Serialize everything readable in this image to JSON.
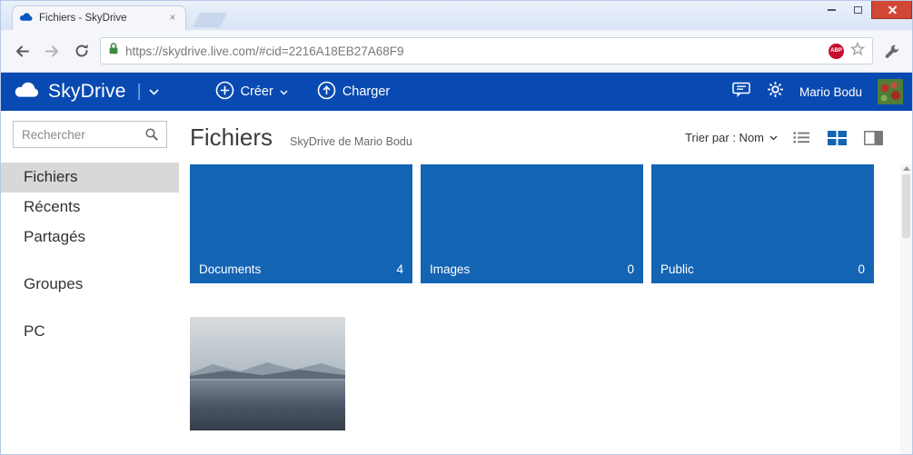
{
  "browser": {
    "tab_title": "Fichiers - SkyDrive",
    "url": "https://skydrive.live.com/#cid=2216A18EB27A68F9",
    "abp_badge": "ABP"
  },
  "app_header": {
    "brand": "SkyDrive",
    "create_label": "Créer",
    "upload_label": "Charger",
    "user_name": "Mario Bodu"
  },
  "sidebar": {
    "search_placeholder": "Rechercher",
    "items": [
      {
        "label": "Fichiers"
      },
      {
        "label": "Récents"
      },
      {
        "label": "Partagés"
      },
      {
        "label": "Groupes"
      },
      {
        "label": "PC"
      }
    ]
  },
  "content": {
    "title": "Fichiers",
    "subtitle": "SkyDrive de Mario Bodu",
    "sort_label": "Trier par : Nom",
    "folders": [
      {
        "name": "Documents",
        "count": "4"
      },
      {
        "name": "Images",
        "count": "0"
      },
      {
        "name": "Public",
        "count": "0"
      }
    ]
  },
  "colors": {
    "header_blue": "#094ab2",
    "tile_blue": "#1464b4",
    "close_red": "#d14836"
  }
}
